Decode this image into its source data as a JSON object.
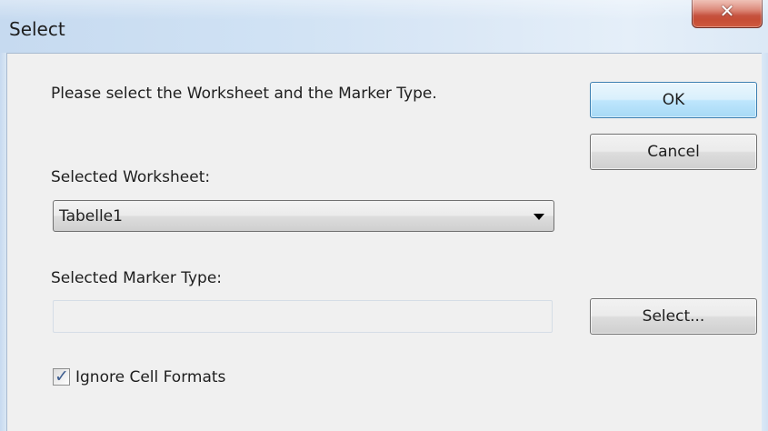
{
  "window": {
    "title": "Select",
    "close_glyph": "✕"
  },
  "dialog": {
    "instruction": "Please select the Worksheet and the Marker Type.",
    "ok_label": "OK",
    "cancel_label": "Cancel",
    "worksheet_label": "Selected Worksheet:",
    "worksheet_value": "Tabelle1",
    "marker_label": "Selected Marker Type:",
    "marker_value": "",
    "select_button_label": "Select...",
    "ignore_formats_label": "Ignore Cell Formats",
    "ignore_formats_checked": true,
    "check_glyph": "✓"
  }
}
